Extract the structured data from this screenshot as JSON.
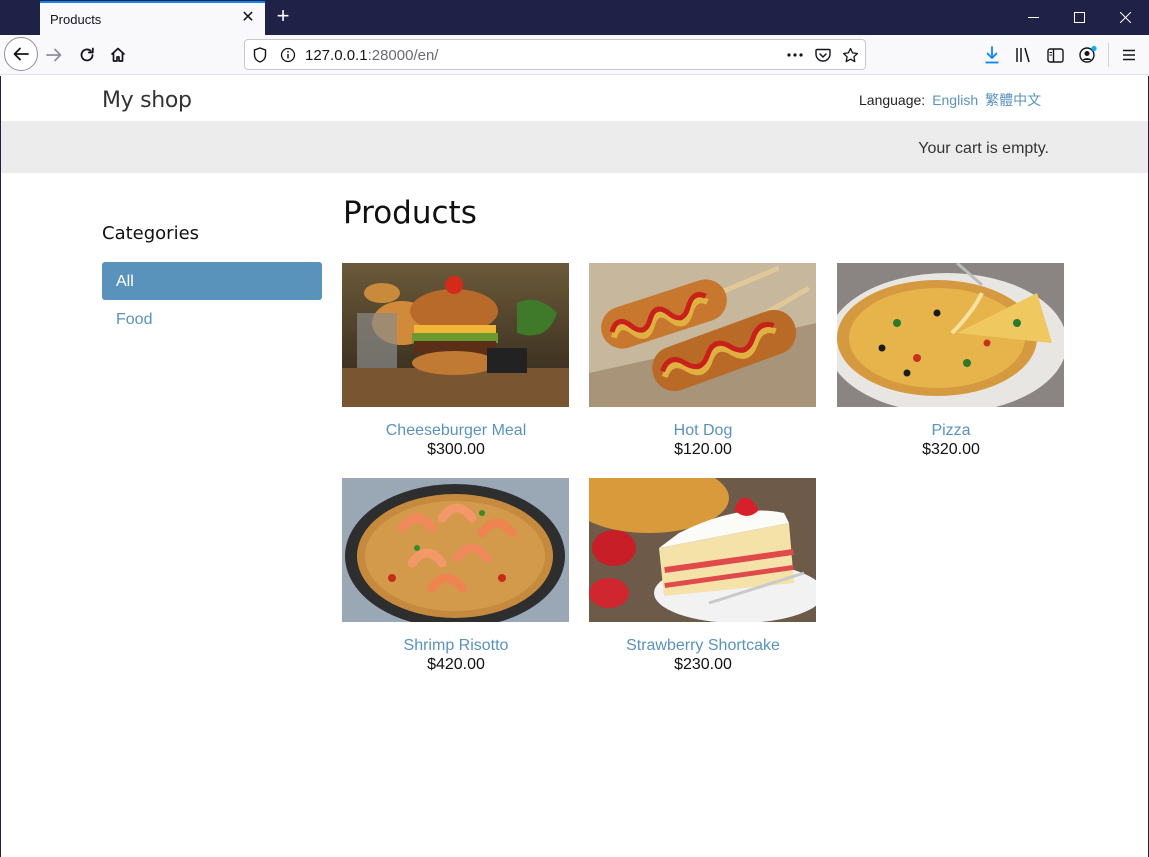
{
  "browser": {
    "tab_title": "Products",
    "url_host": "127.0.0.1",
    "url_rest": ":28000/en/"
  },
  "site": {
    "logo": "My shop",
    "language_label": "Language:",
    "languages": [
      "English",
      "繁體中文"
    ],
    "cart_status": "Your cart is empty."
  },
  "sidebar": {
    "title": "Categories",
    "items": [
      {
        "label": "All",
        "active": true
      },
      {
        "label": "Food",
        "active": false
      }
    ]
  },
  "main": {
    "title": "Products",
    "products": [
      {
        "name": "Cheeseburger Meal",
        "price": "$300.00"
      },
      {
        "name": "Hot Dog",
        "price": "$120.00"
      },
      {
        "name": "Pizza",
        "price": "$320.00"
      },
      {
        "name": "Shrimp Risotto",
        "price": "$420.00"
      },
      {
        "name": "Strawberry Shortcake",
        "price": "$230.00"
      }
    ]
  },
  "colors": {
    "accent": "#5993bb",
    "titlebar": "#1f2246",
    "cartbar": "#ececec"
  }
}
